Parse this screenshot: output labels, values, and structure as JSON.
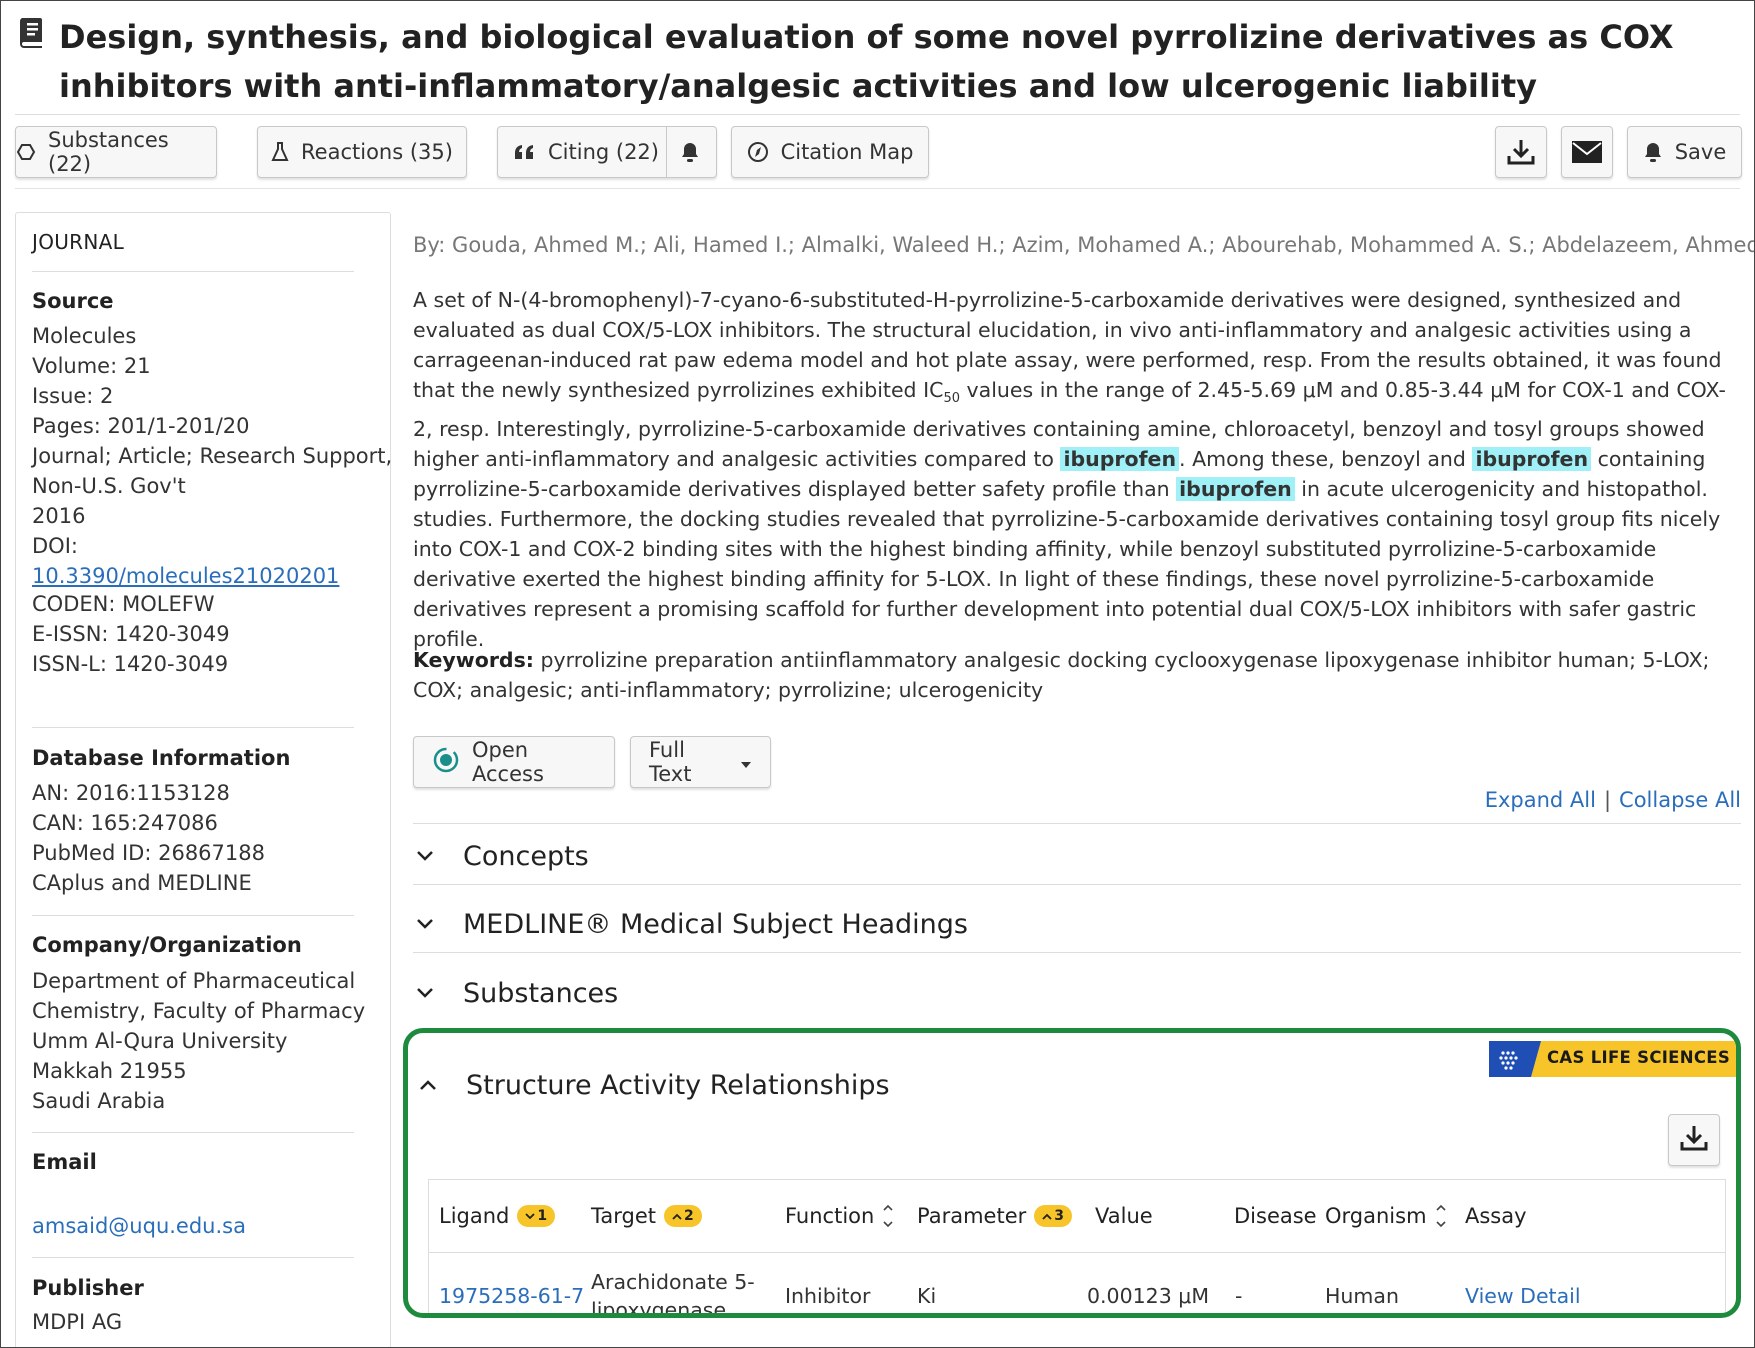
{
  "title": "Design, synthesis, and biological evaluation of some novel pyrrolizine derivatives as COX inhibitors with anti-inflammatory/analgesic activities and low ulcerogenic liability",
  "toolbar": {
    "substances": "Substances (22)",
    "reactions": "Reactions (35)",
    "citing": "Citing (22)",
    "citation_map": "Citation Map",
    "save": "Save"
  },
  "sidebar": {
    "journal_heading": "JOURNAL",
    "source_label": "Source",
    "source": "Molecules",
    "volume": "Volume: 21",
    "issue": "Issue: 2",
    "pages": "Pages: 201/1-201/20",
    "doc_type_1": "Journal; Article; Research Support,",
    "doc_type_2": "Non-U.S. Gov't",
    "year": "2016",
    "doi_label": "DOI:",
    "doi": "10.3390/molecules21020201",
    "coden": "CODEN: MOLEFW",
    "eissn": "E-ISSN: 1420-3049",
    "issnl": "ISSN-L: 1420-3049",
    "db_label": "Database Information",
    "an": "AN: 2016:1153128",
    "can": "CAN: 165:247086",
    "pubmed": "PubMed ID: 26867188",
    "db_source": "CAplus and MEDLINE",
    "org_label": "Company/Organization",
    "org_1": "Department of Pharmaceutical",
    "org_2": "Chemistry, Faculty of Pharmacy",
    "org_3": "Umm Al-Qura University",
    "org_4": "Makkah 21955",
    "org_5": "Saudi Arabia",
    "email_label": "Email",
    "email": "amsaid@uqu.edu.sa",
    "publisher_label": "Publisher",
    "publisher": "MDPI AG"
  },
  "main": {
    "authors": "By: Gouda, Ahmed M.; Ali, Hamed I.; Almalki, Waleed H.; Azim, Mohamed A.; Abourehab, Mohammed A. S.; Abdelazeem, Ahmed H.",
    "abstract_1": "A set of N-(4-bromophenyl)-7-cyano-6-substituted-H-pyrrolizine-5-carboxamide derivatives were designed, synthesized and evaluated as dual COX/5-LOX inhibitors. The structural elucidation, in vivo anti-inflammatory and analgesic activities using a carrageenan-induced rat paw edema model and hot plate assay, were performed, resp. From the results obtained, it was found that the newly synthesized pyrrolizines exhibited IC",
    "abstract_sub": "50",
    "abstract_2": " values in the range of 2.45-5.69 μM and 0.85-3.44 μM for COX-1 and COX-2, resp. Interestingly, pyrrolizine-5-carboxamide derivatives containing amine, chloroacetyl, benzoyl and tosyl groups showed higher anti-inflammatory and analgesic activities compared to ",
    "highlight": "ibuprofen",
    "abstract_3": ". Among these, benzoyl and ",
    "abstract_4": " containing pyrrolizine-5-carboxamide derivatives displayed better safety profile than ",
    "abstract_5": " in acute ulcerogenicity and histopathol. studies. Furthermore, the docking studies revealed that pyrrolizine-5-carboxamide derivatives containing tosyl group fits nicely into COX-1 and COX-2 binding sites with the highest binding affinity, while benzoyl substituted pyrrolizine-5-carboxamide derivative exerted the highest binding affinity for 5-LOX. In light of these findings, these novel pyrrolizine-5-carboxamide derivatives represent a promising scaffold for further development into potential dual COX/5-LOX inhibitors with safer gastric profile.",
    "keywords_label": "Keywords:",
    "keywords": "pyrrolizine preparation antiinflammatory analgesic docking cyclooxygenase lipoxygenase inhibitor human; 5-LOX; COX; analgesic; anti-inflammatory; pyrrolizine; ulcerogenicity",
    "open_access": "Open Access",
    "full_text": "Full Text",
    "expand_all": "Expand All",
    "separator": "|",
    "collapse_all": "Collapse All",
    "sections": {
      "concepts": "Concepts",
      "mesh": "MEDLINE® Medical Subject Headings",
      "substances": "Substances",
      "sar": "Structure Activity Relationships"
    }
  },
  "sar": {
    "badge": "CAS LIFE SCIENCES",
    "columns": {
      "ligand": "Ligand",
      "ligand_sort": "1",
      "target": "Target",
      "target_sort": "2",
      "function": "Function",
      "parameter": "Parameter",
      "parameter_sort": "3",
      "value": "Value",
      "disease": "Disease",
      "organism": "Organism",
      "assay": "Assay"
    },
    "rows": [
      {
        "ligand": "1975258-61-7",
        "target_1": "Arachidonate 5-",
        "target_2": "lipoxygenase",
        "function": "Inhibitor",
        "parameter": "Ki",
        "value": "0.00123 μM",
        "disease": "-",
        "organism": "Human",
        "assay": "View Detail"
      }
    ]
  },
  "colors": {
    "link": "#2a6ebb",
    "highlight": "#9ff0f7",
    "sar_border": "#1e8a3e",
    "badge_yellow": "#f7c52a",
    "badge_blue": "#1f4fb5"
  },
  "icons": [
    "document-icon",
    "substance-hexagon-icon",
    "flask-icon",
    "quote-icon",
    "bell-icon",
    "compass-icon",
    "download-icon",
    "email-icon",
    "open-access-icon",
    "caret-down-icon",
    "chevron-down-icon",
    "chevron-up-icon",
    "sort-icon"
  ]
}
